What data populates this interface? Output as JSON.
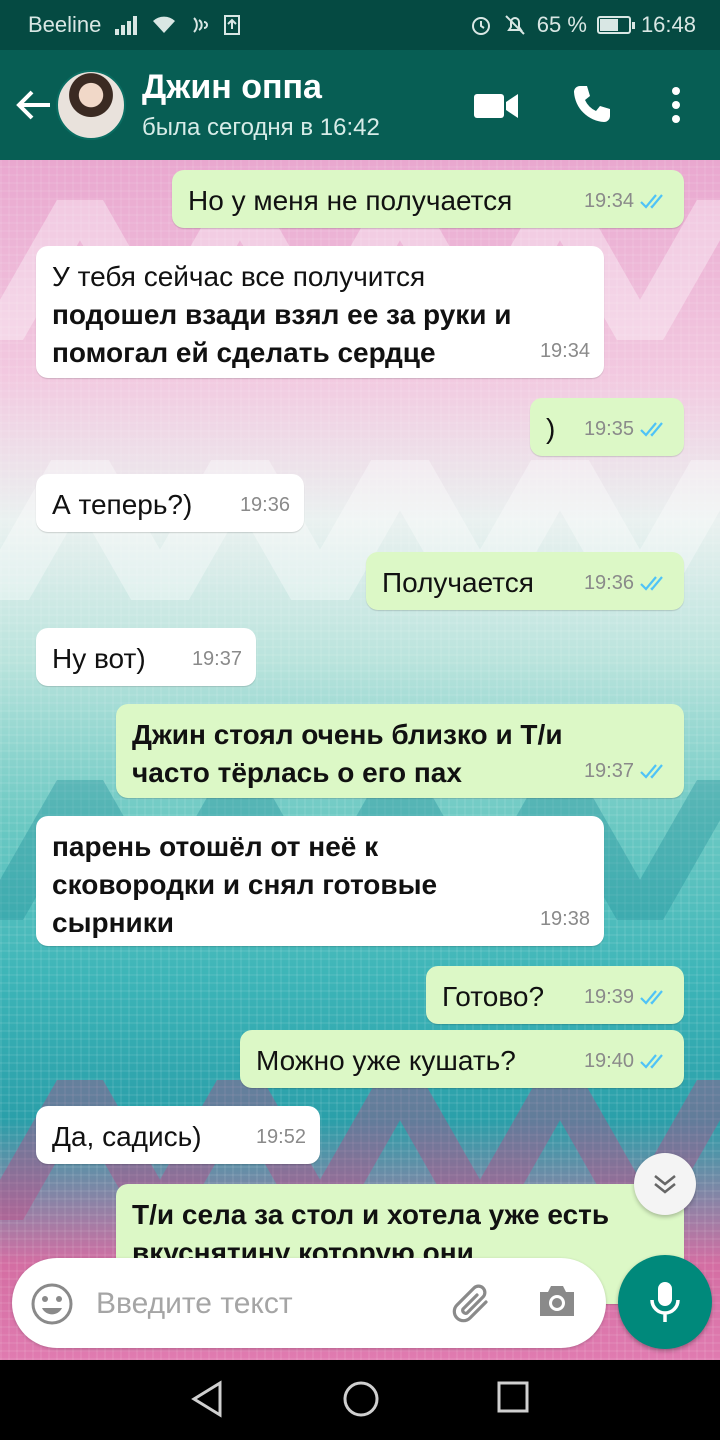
{
  "status": {
    "carrier": "Beeline",
    "battery": "65 %",
    "battery_level": 0.65,
    "time": "16:48"
  },
  "header": {
    "contact_name": "Джин оппа",
    "last_seen": "была сегодня в 16:42",
    "icons": [
      "back-arrow-icon",
      "video-call-icon",
      "phone-icon",
      "more-vert-icon"
    ]
  },
  "messages": [
    {
      "dir": "out",
      "text": "Но у меня не получается",
      "time": "19:34",
      "bold": false
    },
    {
      "dir": "in",
      "text": "У тебя сейчас все получится",
      "text2": "подошел взади взял ее за руки и помогал ей сделать сердце",
      "time": "19:34"
    },
    {
      "dir": "out",
      "text": ")",
      "time": "19:35",
      "bold": false
    },
    {
      "dir": "in",
      "text": "А теперь?)",
      "time": "19:36",
      "bold": false
    },
    {
      "dir": "out",
      "text": "Получается",
      "time": "19:36",
      "bold": false
    },
    {
      "dir": "in",
      "text": "Ну вот)",
      "time": "19:37",
      "bold": false
    },
    {
      "dir": "out",
      "text": "Джин стоял очень близко и Т/и часто тёрлась о его пах",
      "time": "19:37",
      "bold": true
    },
    {
      "dir": "in",
      "text": "парень отошёл от неё к сковородки и снял готовые сырники",
      "time": "19:38",
      "bold": true
    },
    {
      "dir": "out",
      "text": "Готово?",
      "time": "19:39",
      "bold": false
    },
    {
      "dir": "out",
      "text": "Можно уже кушать?",
      "time": "19:40",
      "bold": false
    },
    {
      "dir": "in",
      "text": "Да, садись)",
      "time": "19:52",
      "bold": false
    },
    {
      "dir": "out",
      "text": "Т/и села за стол и хотела уже есть вкуснятину которую они",
      "time": "",
      "bold": true
    }
  ],
  "composer": {
    "placeholder": "Введите текст",
    "icons": [
      "emoji-icon",
      "attach-icon",
      "camera-icon",
      "mic-icon"
    ]
  },
  "colors": {
    "header": "#075E54",
    "outgoing_bubble": "#dcf8c6",
    "incoming_bubble": "#ffffff",
    "read_ticks": "#4fc3f7",
    "fab": "#00897b"
  }
}
